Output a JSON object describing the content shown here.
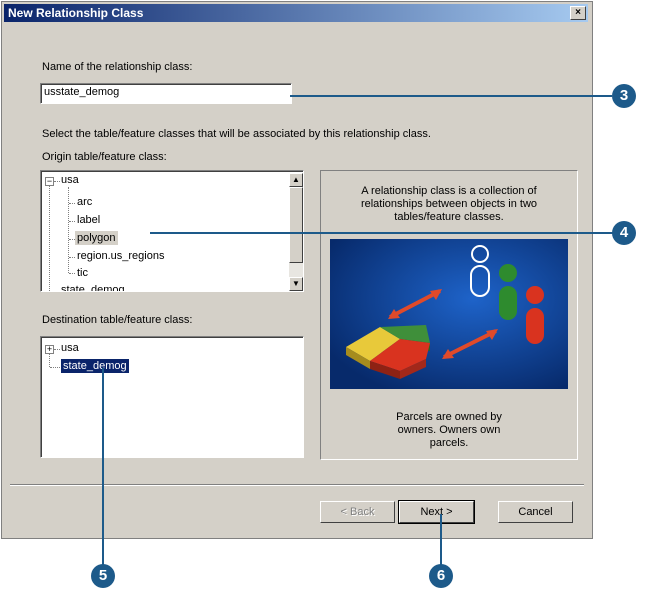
{
  "dialog": {
    "title": "New Relationship Class",
    "close_glyph": "×",
    "name_label": "Name of the relationship class:",
    "name_value": "usstate_demog",
    "select_label": "Select the table/feature classes that will be associated by this relationship class.",
    "origin_label": "Origin table/feature class:",
    "origin_tree": {
      "root": "usa",
      "children": [
        "arc",
        "label",
        "polygon",
        "region.us_regions",
        "tic"
      ],
      "selected": "polygon",
      "partial": "state_demog"
    },
    "destination_label": "Destination table/feature class:",
    "destination_tree": {
      "items": [
        "usa",
        "state_demog"
      ],
      "selected": "state_demog"
    },
    "info_top": "A relationship class is a collection of relationships between objects in two tables/feature classes.",
    "info_bottom": "Parcels are owned by owners. Owners own parcels.",
    "buttons": {
      "back": "< Back",
      "next": "Next >",
      "cancel": "Cancel"
    }
  },
  "callouts": [
    "3",
    "4",
    "5",
    "6"
  ],
  "colors": {
    "callout": "#1d5a8a",
    "title_start": "#0a246a",
    "title_end": "#a6caf0",
    "illustration_bg": "#0b3d91"
  }
}
